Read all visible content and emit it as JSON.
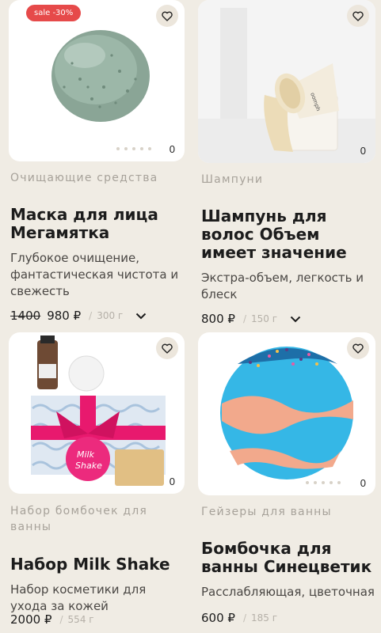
{
  "products": [
    {
      "sale_badge": "sale -30%",
      "count": "0",
      "category": "Очищающие средства",
      "title": "Маска для лица Мегамятка",
      "description": "Глубокое очищение, фантастическая чистота и свежесть",
      "old_price": "1400",
      "price": "980 ₽",
      "slash": "/",
      "weight": "300 г",
      "image": "green-clay-mask"
    },
    {
      "count": "0",
      "category": "Шампуни",
      "title": "Шампунь для волос Объем имеет значение",
      "description": "Экстра-объем, легкость и блеск",
      "price": "800 ₽",
      "slash": "/",
      "weight": "150 г",
      "image": "shampoo-jar"
    },
    {
      "count": "0",
      "category": "Набор бомбочек для ванны",
      "title": "Набор Milk Shake",
      "description": "Набор косметики для ухода за кожей",
      "price": "2000 ₽",
      "slash": "/",
      "weight": "554 г",
      "image": "gift-set-box"
    },
    {
      "count": "0",
      "category": "Гейзеры для ванны",
      "title": "Бомбочка для ванны Синецветик",
      "description": "Расслабляющая, цветочная",
      "price": "600 ₽",
      "slash": "/",
      "weight": "185 г",
      "image": "blue-bath-bomb"
    }
  ],
  "colors": {
    "background": "#f0ece4",
    "sale": "#e64a4a",
    "category": "#a7a29a"
  }
}
